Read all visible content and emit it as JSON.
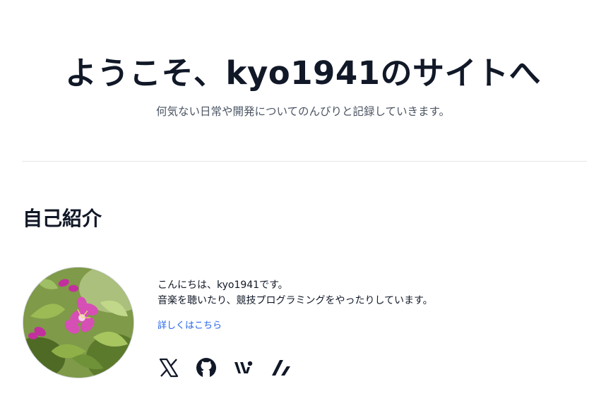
{
  "hero": {
    "title": "ようこそ、kyo1941のサイトへ",
    "subtitle": "何気ない日常や開発についてのんびりと記録していきます。"
  },
  "about": {
    "heading": "自己紹介",
    "avatar_alt": "pink azalea flowers",
    "bio_lines": [
      "こんにちは、kyo1941です。",
      "音楽を聴いたり、競技プログラミングをやったりしています。"
    ],
    "more_link": "詳しくはこちら",
    "link_color": "#2563eb"
  },
  "social": [
    {
      "icon": "x-icon"
    },
    {
      "icon": "github-icon"
    },
    {
      "icon": "wantedly-icon"
    },
    {
      "icon": "zenn-icon"
    }
  ]
}
